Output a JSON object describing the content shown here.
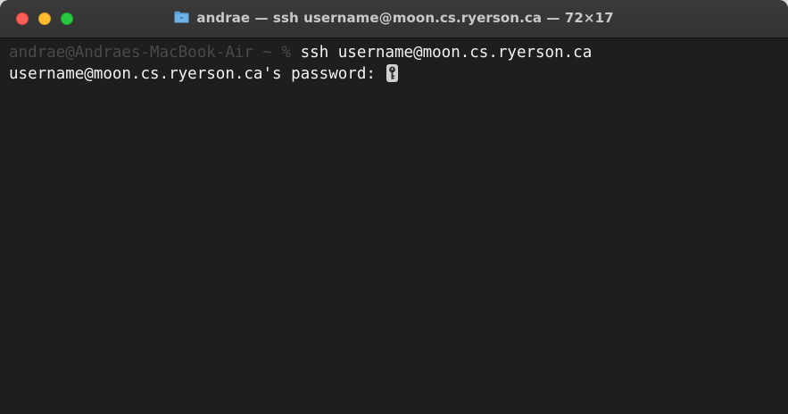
{
  "window": {
    "title_prefix": "andrae",
    "title": "andrae — ssh username@moon.cs.ryerson.ca — 72×17",
    "folder_icon": "folder-icon",
    "buttons": {
      "close_icon": "close-icon",
      "minimize_icon": "minimize-icon",
      "zoom_icon": "zoom-icon"
    }
  },
  "terminal": {
    "line1": {
      "prompt": "andrae@Andraes-MacBook-Air ~ % ",
      "command": "ssh username@moon.cs.ryerson.ca"
    },
    "line2": {
      "text": "username@moon.cs.ryerson.ca's password: ",
      "cursor_icon": "key-cursor-icon"
    }
  },
  "colors": {
    "background": "#1e1e1e",
    "titlebar": "#333333",
    "text": "#f2f2f2",
    "prompt_dim": "#4a4a4a",
    "close": "#ff5f57",
    "minimize": "#febc2e",
    "zoom": "#28c840"
  }
}
